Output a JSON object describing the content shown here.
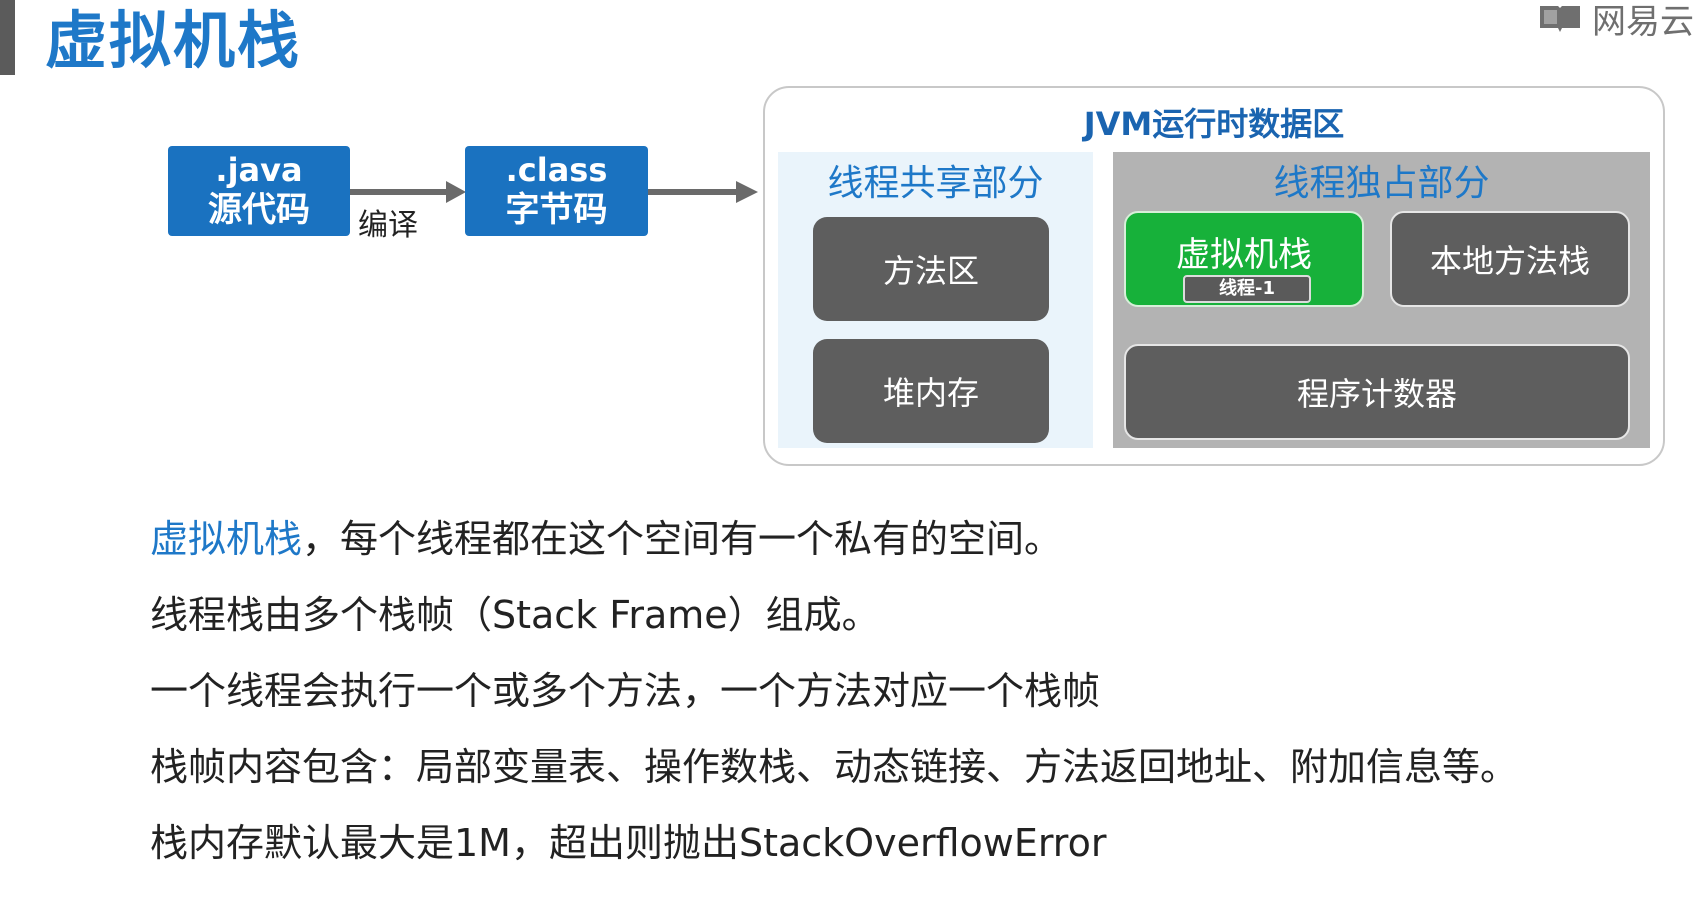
{
  "page_title": "虚拟机栈",
  "logo": {
    "icon": "book-icon",
    "text": "网易云"
  },
  "flow": {
    "java_box": {
      "line1": ".java",
      "line2": "源代码"
    },
    "compile_label": "编译",
    "class_box": {
      "line1": ".class",
      "line2": "字节码"
    }
  },
  "jvm": {
    "title": "JVM运行时数据区",
    "shared": {
      "label": "线程共享部分",
      "items": [
        "方法区",
        "堆内存"
      ]
    },
    "private": {
      "label": "线程独占部分",
      "vm_stack": {
        "label": "虚拟机栈",
        "sub": "线程-1"
      },
      "native_stack": "本地方法栈",
      "pc": "程序计数器"
    }
  },
  "notes": {
    "line1_highlight": "虚拟机栈",
    "line1_rest": "，每个线程都在这个空间有一个私有的空间。",
    "line2": "线程栈由多个栈帧（Stack Frame）组成。",
    "line3": "一个线程会执行一个或多个方法，一个方法对应一个栈帧",
    "line4": "栈帧内容包含：局部变量表、操作数栈、动态链接、方法返回地址、附加信息等。",
    "line5": "栈内存默认最大是1M，超出则抛出StackOverflowError"
  },
  "colors": {
    "accent_blue": "#1e78c8",
    "box_blue": "#1a72c0",
    "green": "#17b13a",
    "gray_box": "#5e5e5e"
  }
}
